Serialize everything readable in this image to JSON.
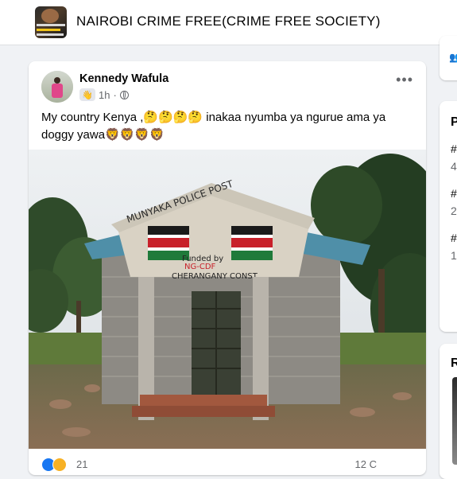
{
  "group": {
    "name": "NAIROBI CRIME FREE(CRIME FREE SOCIETY)"
  },
  "post": {
    "author": "Kennedy Wafula",
    "time": "1h",
    "text_line1": "My country Kenya ,🤔🤔🤔🤔 inakaa nyumba ya ngurue ama ya",
    "text_line2": "doggy yawa🦁🦁🦁🦁",
    "image_text": {
      "roof_sign": "MUNYAKA POLICE POST",
      "wall_text1": "Funded by",
      "wall_text2": "NG-CDF",
      "wall_text3": "CHERANGANY CONST."
    },
    "reaction_count": "21",
    "comments_count": "12 C"
  },
  "right_sidebar": {
    "heading_letter": "P",
    "items": [
      "#",
      "4",
      "#",
      "2",
      "#",
      "1"
    ],
    "second_card_letter": "R"
  },
  "colors": {
    "accent": "#1877f2",
    "flag_black": "#1a1a1a",
    "flag_red": "#c8202a",
    "flag_green": "#1f7a3a"
  }
}
